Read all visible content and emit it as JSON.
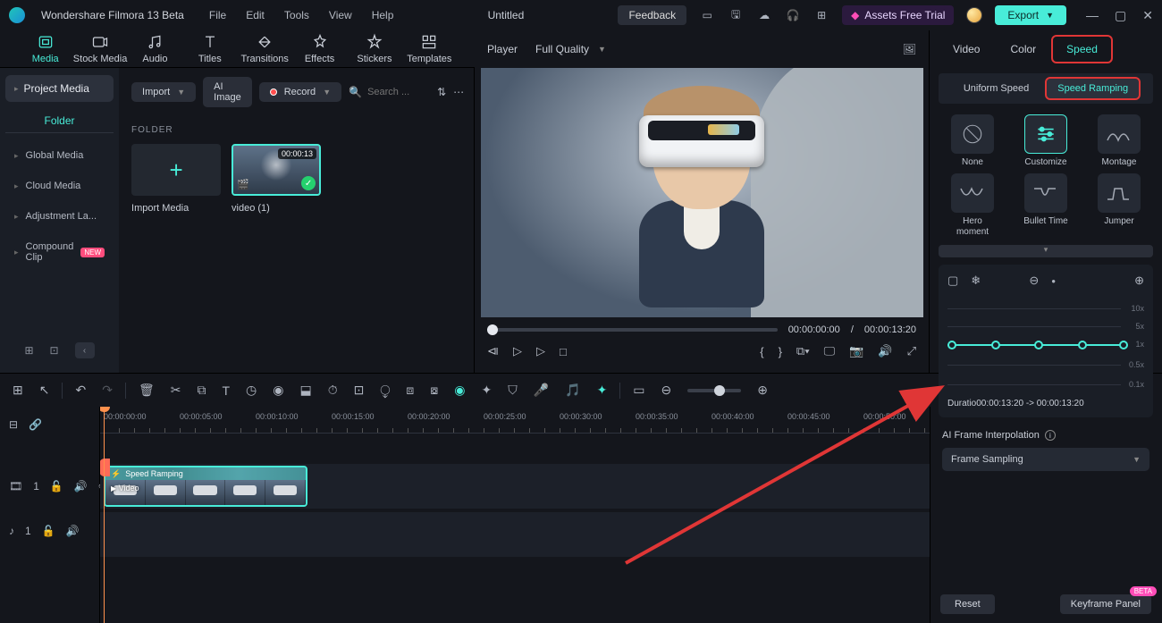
{
  "titlebar": {
    "appName": "Wondershare Filmora 13 Beta",
    "menu": [
      "File",
      "Edit",
      "Tools",
      "View",
      "Help"
    ],
    "document": "Untitled",
    "feedback": "Feedback",
    "assets": "Assets Free Trial",
    "export": "Export"
  },
  "libtabs": [
    {
      "label": "Media",
      "active": true
    },
    {
      "label": "Stock Media"
    },
    {
      "label": "Audio"
    },
    {
      "label": "Titles"
    },
    {
      "label": "Transitions"
    },
    {
      "label": "Effects"
    },
    {
      "label": "Stickers"
    },
    {
      "label": "Templates"
    }
  ],
  "sidebar": {
    "header": "Project Media",
    "sub": "Folder",
    "items": [
      {
        "label": "Global Media"
      },
      {
        "label": "Cloud Media"
      },
      {
        "label": "Adjustment La..."
      },
      {
        "label": "Compound Clip",
        "new": true
      }
    ]
  },
  "contentToolbar": {
    "import": "Import",
    "aiImage": "AI Image",
    "record": "Record",
    "searchPlaceholder": "Search ..."
  },
  "contentSection": "FOLDER",
  "tiles": [
    {
      "label": "Import Media",
      "type": "add"
    },
    {
      "label": "video (1)",
      "type": "video",
      "duration": "00:00:13"
    }
  ],
  "player": {
    "tab": "Player",
    "quality": "Full Quality",
    "timeCurrent": "00:00:00:00",
    "timeSep": "/",
    "timeTotal": "00:00:13:20"
  },
  "rightPanel": {
    "tabs": [
      {
        "label": "Video"
      },
      {
        "label": "Color"
      },
      {
        "label": "Speed",
        "active": true
      }
    ],
    "subtabs": [
      {
        "label": "Uniform Speed"
      },
      {
        "label": "Speed Ramping",
        "active": true
      }
    ],
    "presets": [
      {
        "label": "None",
        "icon": "none"
      },
      {
        "label": "Customize",
        "icon": "customize",
        "active": true
      },
      {
        "label": "Montage",
        "icon": "montage"
      },
      {
        "label": "Hero moment",
        "icon": "hero"
      },
      {
        "label": "Bullet Time",
        "icon": "bullet"
      },
      {
        "label": "Jumper",
        "icon": "jumper"
      }
    ],
    "axis": [
      "10x",
      "5x",
      "1x",
      "0.5x",
      "0.1x"
    ],
    "durationPrefix": "Duratio",
    "durationValue": "00:00:13:20 -> 00:00:13:20",
    "aiLabel": "AI Frame Interpolation",
    "aiSelect": "Frame Sampling",
    "reset": "Reset",
    "keyframe": "Keyframe Panel",
    "beta": "BETA"
  },
  "timeline": {
    "marks": [
      "00:00:00:00",
      "00:00:05:00",
      "00:00:10:00",
      "00:00:15:00",
      "00:00:20:00",
      "00:00:25:00",
      "00:00:30:00",
      "00:00:35:00",
      "00:00:40:00",
      "00:00:45:00",
      "00:00:50:00"
    ],
    "clipBadge": "Speed Ramping",
    "clipLabel": "Video",
    "videoTrack": "1",
    "audioTrack": "1"
  }
}
